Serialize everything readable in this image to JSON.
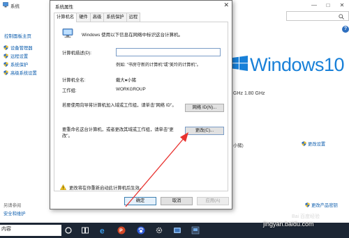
{
  "background_window": {
    "title": "系统",
    "sidebar_home": "控制面板主页",
    "sidebar_items": [
      "设备管理器",
      "远程设置",
      "系统保护",
      "高级系统设置"
    ],
    "see_also": "另请参阅",
    "security": "安全和维护",
    "os_logo_text": "Windows10",
    "cpu_text": "GHz   1.80 GHz",
    "small_text": "小猪)",
    "change_settings": "更改设置",
    "change_key": "更改产品密钥"
  },
  "dialog": {
    "title": "系统属性",
    "close_glyph": "✕",
    "tabs": [
      "计算机名",
      "硬件",
      "高级",
      "系统保护",
      "远程"
    ],
    "active_tab": "计算机名",
    "description": "Windows 使用以下信息在网络中标识这台计算机。",
    "desc_label": "计算机描述(D):",
    "desc_value": "",
    "example": "例如: \"书房守新的计算机\"或\"美玲的计算机\"。",
    "full_name_label": "计算机全名:",
    "full_name_value": "戴大●小猪",
    "workgroup_label": "工作组:",
    "workgroup_value": "WORKGROUP",
    "network_id_text": "若要使用向导将计算机加入域或工作组，请单击\"网络 ID\"。",
    "network_id_button": "网络 ID(N)...",
    "rename_text": "要重命名这台计算机，或者更改其域或工作组，请单击\"更改\"。",
    "change_button": "更改(C)...",
    "warning": "更改将在你重新启动此计算机后生效。",
    "ok": "确定",
    "cancel": "取消",
    "apply": "应用(A)"
  },
  "taskbar": {
    "left_text": "内容",
    "watermark": "jingyan.baidu.com",
    "baidu_logo": "Bai 百度经验"
  },
  "colors": {
    "accent": "#1880d8",
    "arrow": "#e8322f",
    "taskbar": "#1c2634",
    "link": "#0b5cad"
  }
}
